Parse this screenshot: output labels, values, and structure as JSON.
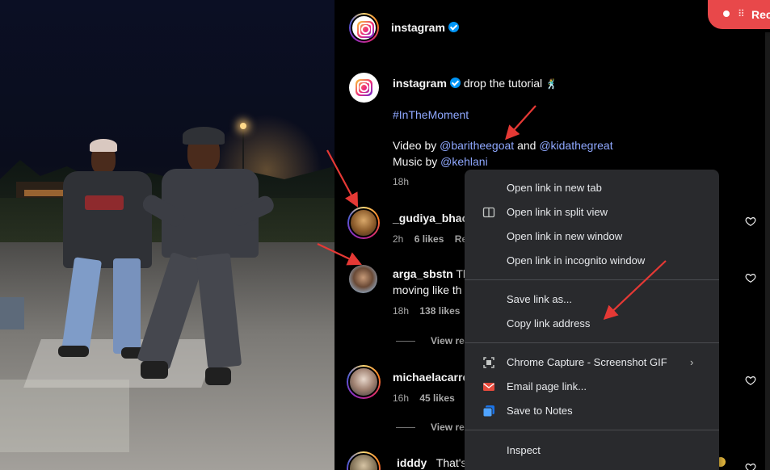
{
  "recording": {
    "label": "Rec",
    "grip": "⠿"
  },
  "post": {
    "account": "instagram",
    "caption_text": "drop the tutorial",
    "caption_emoji": "🕺",
    "hashtag": "#InTheMoment",
    "video_by_prefix": "Video by",
    "video_by_1": "@baritheegoat",
    "and_text": "and",
    "video_by_2": "@kidathegreat",
    "music_by_prefix": "Music by",
    "music_by": "@kehlani",
    "age": "18h"
  },
  "comments": [
    {
      "user": "_gudiya_bhac",
      "text": "",
      "age": "2h",
      "likes": "6 likes",
      "reply": "Re"
    },
    {
      "user": "arga_sbstn",
      "text": "Th",
      "text2": "moving like th",
      "age": "18h",
      "likes": "138 likes",
      "view_replies": "View re"
    },
    {
      "user": "michaelacarro",
      "text": "",
      "age": "16h",
      "likes": "45 likes",
      "view_replies": "View re"
    },
    {
      "user": "idddy",
      "text": "That's"
    }
  ],
  "context_menu": {
    "items": [
      {
        "label": "Open link in new tab",
        "icon": "none"
      },
      {
        "label": "Open link in split view",
        "icon": "split-view-icon"
      },
      {
        "label": "Open link in new window",
        "icon": "none"
      },
      {
        "label": "Open link in incognito window",
        "icon": "none"
      },
      {
        "label": "Save link as...",
        "icon": "none"
      },
      {
        "label": "Copy link address",
        "icon": "none"
      },
      {
        "label": "Chrome Capture - Screenshot  GIF",
        "icon": "capture-icon",
        "submenu": true
      },
      {
        "label": "Email page link...",
        "icon": "email-icon"
      },
      {
        "label": "Save to Notes",
        "icon": "notes-icon"
      },
      {
        "label": "Inspect",
        "icon": "none"
      }
    ]
  },
  "colors": {
    "accent_link": "#8fa8ff",
    "verified_blue": "#0095f6",
    "menu_bg": "#292a2d",
    "annotation_red": "#e53935",
    "rec_red": "#e8484a"
  }
}
